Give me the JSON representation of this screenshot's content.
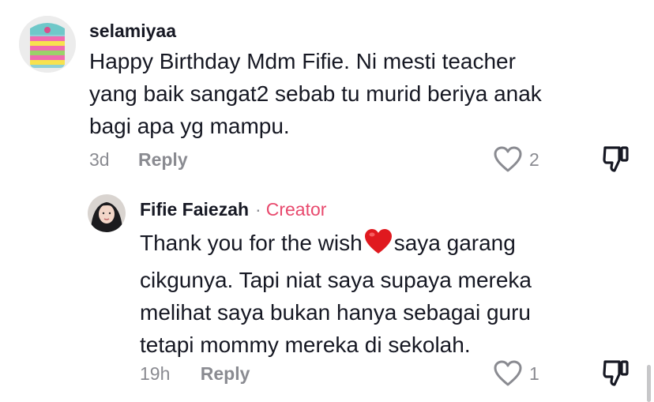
{
  "comments": [
    {
      "username": "selamiyaa",
      "text": "Happy Birthday Mdm Fifie. Ni mesti teacher yang baik sangat2 sebab tu murid beriya anak bagi apa yg mampu.",
      "lines": [
        "Happy Birthday Mdm Fifie. Ni mesti teacher",
        "yang baik sangat2 sebab tu murid beriya anak",
        "bagi apa yg mampu."
      ],
      "time": "3d",
      "reply_label": "Reply",
      "likes": "2"
    },
    {
      "username": "Fifie Faiezah",
      "separator": "·",
      "badge": "Creator",
      "lines": [
        "Thank you for the wish",
        "saya garang",
        "cikgunya. Tapi niat saya supaya mereka",
        "melihat saya bukan hanya sebagai guru",
        "tetapi mommy mereka di sekolah."
      ],
      "time": "19h",
      "reply_label": "Reply",
      "likes": "1"
    }
  ],
  "colors": {
    "text": "#161823",
    "secondary": "#8a8b91",
    "creator_badge": "#e8496d",
    "heart_emoji": "#e0191f"
  },
  "icons": [
    "heart-outline-icon",
    "thumbs-down-icon",
    "red-heart-emoji"
  ]
}
